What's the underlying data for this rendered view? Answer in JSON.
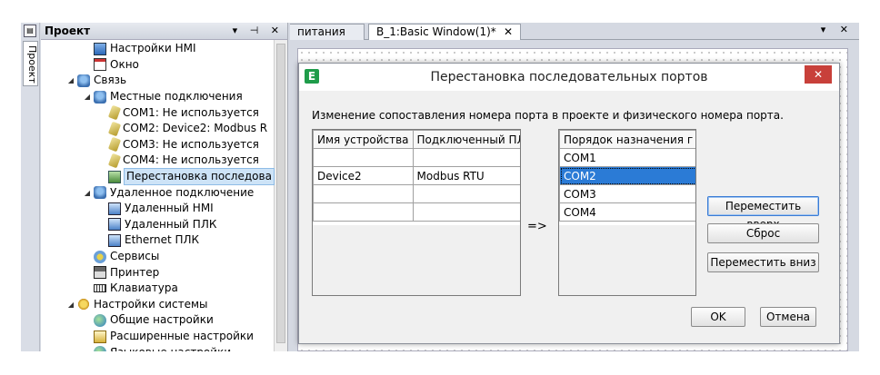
{
  "sidebar_strip": {
    "tab_label": "Проект"
  },
  "project_panel": {
    "title": "Проект",
    "controls": "▾ ⊣ ✕",
    "tree": [
      {
        "label": "Настройки HMI",
        "level": 2,
        "icon": "hmi-settings-icon",
        "twisty": ""
      },
      {
        "label": "Окно",
        "level": 2,
        "icon": "window-icon",
        "twisty": ""
      },
      {
        "label": "Связь",
        "level": 1,
        "icon": "network-icon",
        "twisty": "◢"
      },
      {
        "label": "Местные подключения",
        "level": 2,
        "icon": "local-connection-icon",
        "twisty": "◢"
      },
      {
        "label": "COM1: Не используется",
        "level": 3,
        "icon": "com-port-icon",
        "twisty": ""
      },
      {
        "label": "COM2: Device2: Modbus R",
        "level": 3,
        "icon": "com-port-icon",
        "twisty": ""
      },
      {
        "label": "COM3: Не используется",
        "level": 3,
        "icon": "com-port-icon",
        "twisty": ""
      },
      {
        "label": "COM4: Не используется",
        "level": 3,
        "icon": "com-port-icon",
        "twisty": ""
      },
      {
        "label": "Перестановка последова",
        "level": 3,
        "icon": "port-swap-icon",
        "twisty": "",
        "selected": true
      },
      {
        "label": "Удаленное подключение",
        "level": 2,
        "icon": "remote-connection-icon",
        "twisty": "◢"
      },
      {
        "label": "Удаленный HMI",
        "level": 3,
        "icon": "remote-hmi-icon",
        "twisty": ""
      },
      {
        "label": "Удаленный ПЛК",
        "level": 3,
        "icon": "remote-plc-icon",
        "twisty": ""
      },
      {
        "label": "Ethernet ПЛК",
        "level": 3,
        "icon": "ethernet-plc-icon",
        "twisty": ""
      },
      {
        "label": "Сервисы",
        "level": 2,
        "icon": "services-icon",
        "twisty": ""
      },
      {
        "label": "Принтер",
        "level": 2,
        "icon": "printer-icon",
        "twisty": ""
      },
      {
        "label": "Клавиатура",
        "level": 2,
        "icon": "keyboard-icon",
        "twisty": ""
      },
      {
        "label": "Настройки системы",
        "level": 1,
        "icon": "system-settings-icon",
        "twisty": "◢"
      },
      {
        "label": "Общие настройки",
        "level": 2,
        "icon": "general-settings-icon",
        "twisty": ""
      },
      {
        "label": "Расширенные настройки",
        "level": 2,
        "icon": "advanced-settings-icon",
        "twisty": ""
      },
      {
        "label": "Языковые настройки",
        "level": 2,
        "icon": "language-settings-icon",
        "twisty": ""
      }
    ]
  },
  "tabs": [
    {
      "label": "питания"
    },
    {
      "label": "B_1:Basic Window(1)*",
      "close": "✕"
    }
  ],
  "tabbar_controls": "▾ ✕",
  "dialog": {
    "logo": "E",
    "title": "Перестановка последовательных портов",
    "close": "✕",
    "description": "Изменение сопоставления номера порта в проекте и физического номера порта.",
    "device_table": {
      "headers": [
        "Имя устройства",
        "Подключенный ПЛ"
      ],
      "rows": [
        [
          "",
          ""
        ],
        [
          "Device2",
          "Modbus RTU"
        ],
        [
          "",
          ""
        ],
        [
          "",
          ""
        ]
      ]
    },
    "arrow": "=>",
    "order_table": {
      "header": "Порядок назначения г",
      "rows": [
        "COM1",
        "COM2",
        "COM3",
        "COM4"
      ],
      "selected_index": 1
    },
    "buttons": {
      "move_up": "Переместить вверх",
      "reset": "Сброс",
      "move_down": "Переместить вниз",
      "ok": "OK",
      "cancel": "Отмена"
    }
  }
}
